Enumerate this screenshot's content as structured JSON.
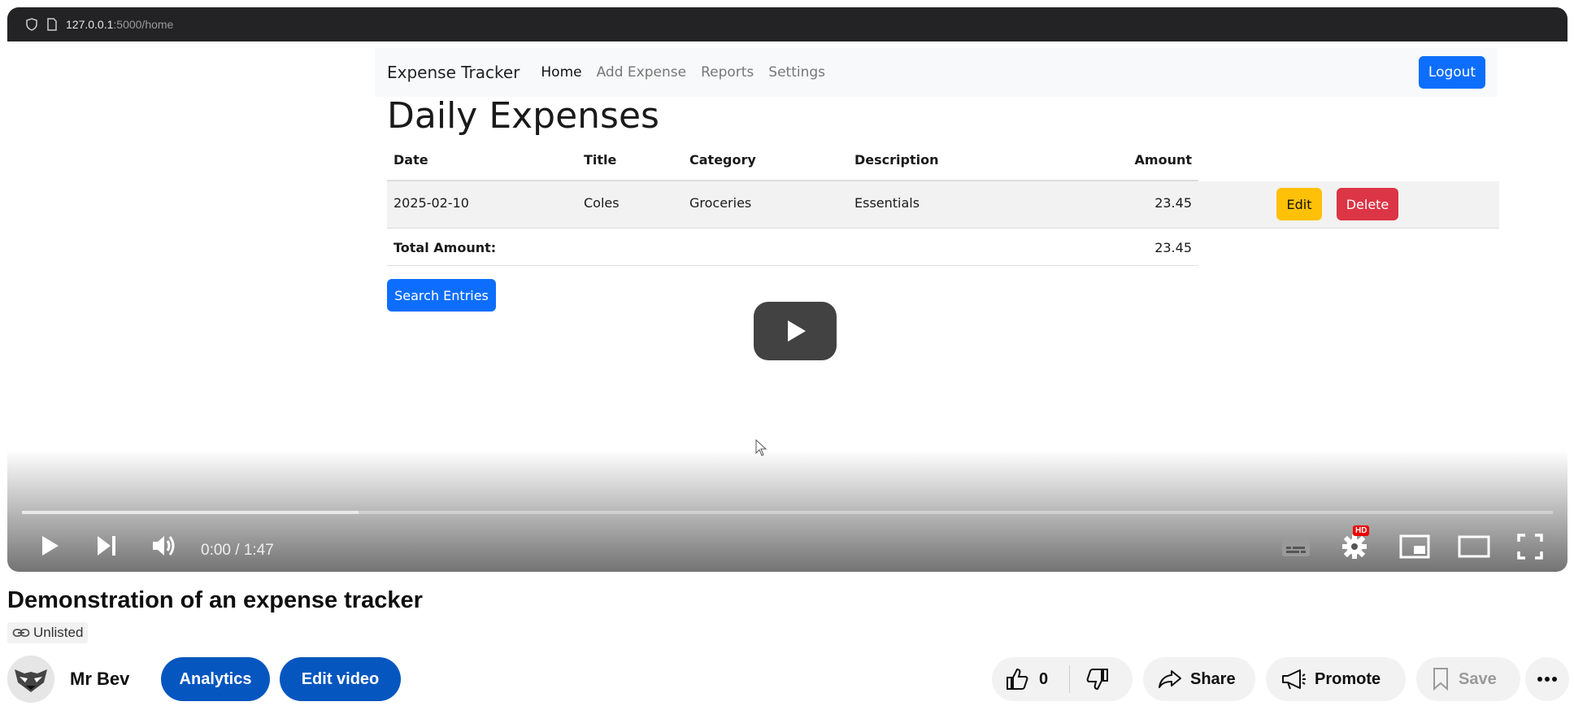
{
  "browser": {
    "url_host": "127.0.0.1",
    "url_path": ":5000/home"
  },
  "app": {
    "brand": "Expense Tracker",
    "nav": [
      "Home",
      "Add Expense",
      "Reports",
      "Settings"
    ],
    "logout": "Logout",
    "heading": "Daily Expenses",
    "columns": [
      "Date",
      "Title",
      "Category",
      "Description",
      "Amount"
    ],
    "rows": [
      {
        "date": "2025-02-10",
        "title": "Coles",
        "category": "Groceries",
        "description": "Essentials",
        "amount": "23.45"
      }
    ],
    "edit_label": "Edit",
    "delete_label": "Delete",
    "total_label": "Total Amount:",
    "total_value": "23.45",
    "search_label": "Search Entries"
  },
  "player": {
    "time_current": "0:00",
    "time_total": "1:47",
    "time_display": "0:00 / 1:47",
    "buffered_fraction": 0.22,
    "hd_badge": "HD",
    "icons": [
      "play-icon",
      "next-icon",
      "volume-icon",
      "subtitles-icon",
      "settings-icon",
      "miniplayer-icon",
      "theater-icon",
      "fullscreen-icon"
    ]
  },
  "video": {
    "title": "Demonstration of an expense tracker",
    "visibility": "Unlisted"
  },
  "channel": {
    "name": "Mr Bev",
    "analytics": "Analytics",
    "edit_video": "Edit video",
    "likes": "0",
    "share": "Share",
    "promote": "Promote",
    "save": "Save"
  },
  "colors": {
    "primary": "#0d6efd",
    "warning": "#ffc107",
    "danger": "#dc3545",
    "yt_blue": "#0556bf"
  }
}
